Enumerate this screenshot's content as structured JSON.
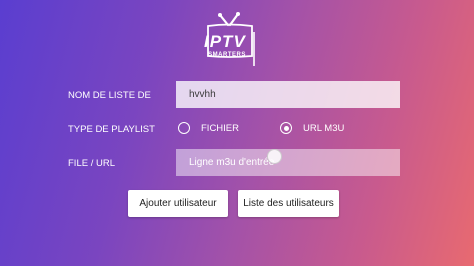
{
  "logo": {
    "main_text": "IPTV",
    "sub_text": "SMARTERS"
  },
  "form": {
    "playlist_name": {
      "label": "NOM DE LISTE DE",
      "value": "hvvhh"
    },
    "playlist_type": {
      "label": "TYPE DE PLAYLIST",
      "options": [
        {
          "label": "FICHIER",
          "selected": false
        },
        {
          "label": "URL M3U",
          "selected": true
        }
      ]
    },
    "file_url": {
      "label": "FILE / URL",
      "value": "",
      "placeholder": "Ligne m3u d'entrée"
    }
  },
  "actions": {
    "add_user_label": "Ajouter utilisateur",
    "user_list_label": "Liste des utilisateurs"
  },
  "colors": {
    "gradient_start": "#5a3ed0",
    "gradient_mid": "#a452a8",
    "gradient_end": "#e86a70",
    "field_bg": "#ffffff",
    "button_bg": "#ffffff"
  }
}
